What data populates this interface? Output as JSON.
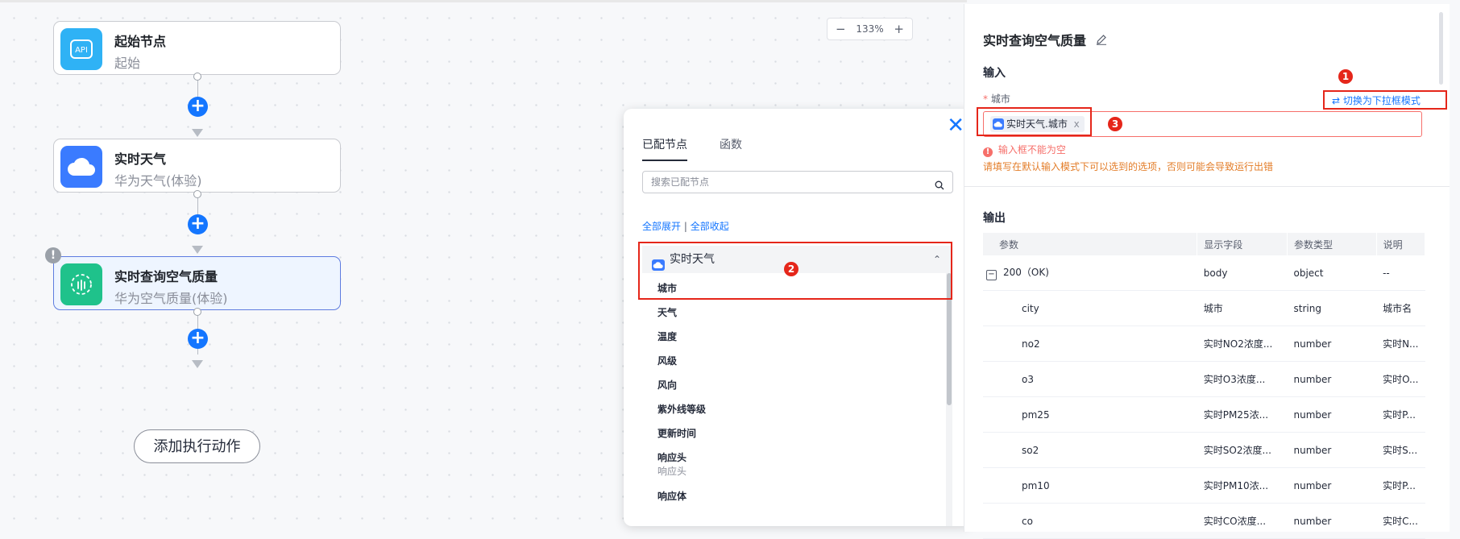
{
  "canvas": {
    "zoom": {
      "minus": "−",
      "value": "133%",
      "plus": "+"
    },
    "nodes": [
      {
        "title": "起始节点",
        "subtitle": "起始",
        "icon": "api-icon",
        "color": "#2fb2f5"
      },
      {
        "title": "实时天气",
        "subtitle": "华为天气(体验)",
        "icon": "cloud-icon",
        "color": "#3a7bff"
      },
      {
        "title": "实时查询空气质量",
        "subtitle": "华为空气质量(体验)",
        "icon": "air-quality-icon",
        "color": "#1fc28b"
      }
    ],
    "warning_badge": "!",
    "add_symbol": "+",
    "add_action_label": "添加执行动作"
  },
  "popup": {
    "close": "✕",
    "tabs": [
      "已配节点",
      "函数"
    ],
    "active_tab": "已配节点",
    "search_placeholder": "搜索已配节点",
    "expand_all": "全部展开",
    "separator": "|",
    "collapse_all": "全部收起",
    "group": {
      "label": "实时天气",
      "chevron": "⌃"
    },
    "fields": [
      {
        "label": "城市"
      },
      {
        "label": "天气"
      },
      {
        "label": "温度"
      },
      {
        "label": "风级"
      },
      {
        "label": "风向"
      },
      {
        "label": "紫外线等级"
      },
      {
        "label": "更新时间"
      },
      {
        "label": "响应头",
        "sub": "响应头"
      },
      {
        "label": "响应体"
      }
    ]
  },
  "panel": {
    "title": "实时查询空气质量",
    "input_section": "输入",
    "city_label": "城市",
    "required_mark": "*",
    "switch_mode": "切换为下拉框模式",
    "tag_value": "实时天气.城市",
    "tag_close": "x",
    "error": "输入框不能为空",
    "hint": "请填写在默认输入模式下可以选到的选项，否则可能会导致运行出错",
    "output_section": "输出",
    "table": {
      "headers": [
        "参数",
        "显示字段",
        "参数类型",
        "说明"
      ],
      "rows": [
        {
          "param": "200（OK)",
          "display": "body",
          "type": "object",
          "desc": "--",
          "collapsible": true
        },
        {
          "param": "city",
          "display": "城市",
          "type": "string",
          "desc": "城市名"
        },
        {
          "param": "no2",
          "display": "实时NO2浓度...",
          "type": "number",
          "desc": "实时N..."
        },
        {
          "param": "o3",
          "display": "实时O3浓度...",
          "type": "number",
          "desc": "实时O..."
        },
        {
          "param": "pm25",
          "display": "实时PM25浓...",
          "type": "number",
          "desc": "实时P..."
        },
        {
          "param": "so2",
          "display": "实时SO2浓度...",
          "type": "number",
          "desc": "实时S..."
        },
        {
          "param": "pm10",
          "display": "实时PM10浓...",
          "type": "number",
          "desc": "实时P..."
        },
        {
          "param": "co",
          "display": "实时CO浓度...",
          "type": "number",
          "desc": "实时C..."
        }
      ]
    }
  },
  "annotations": {
    "badge1": "1",
    "badge2": "2",
    "badge3": "3",
    "color": "#e5261a"
  }
}
